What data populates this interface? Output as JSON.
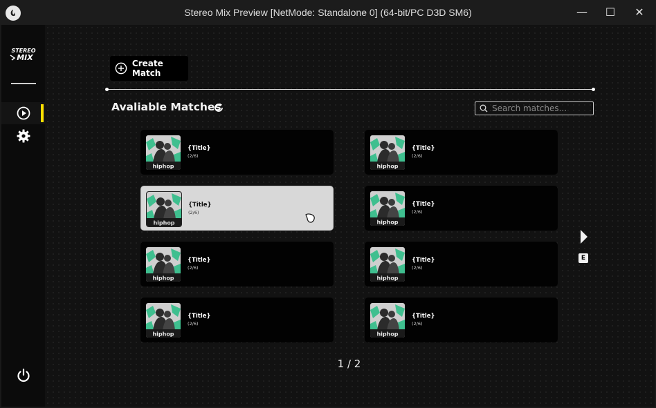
{
  "window": {
    "title": "Stereo Mix Preview [NetMode: Standalone 0]  (64-bit/PC D3D SM6)",
    "minimize_glyph": "—",
    "maximize_glyph": "☐",
    "close_glyph": "✕"
  },
  "brand": {
    "logo_text_line1": "STEREO",
    "logo_text_line2": "MIX"
  },
  "sidebar": {
    "items": [
      {
        "icon": "play-icon",
        "active": true
      },
      {
        "icon": "gear-icon",
        "active": false
      }
    ],
    "bottom_icon": "power-icon",
    "indicator_color": "#ffe000"
  },
  "toolbar": {
    "create_label": "Create Match"
  },
  "section": {
    "title": "Avaliable Matches"
  },
  "search": {
    "placeholder": "Search matches..."
  },
  "matches": [
    {
      "title": "{Title}",
      "players": "(2/6)",
      "thumb_label": "hiphop"
    },
    {
      "title": "{Title}",
      "players": "(2/6)",
      "thumb_label": "hiphop"
    },
    {
      "title": "{Title}",
      "players": "(2/6)",
      "thumb_label": "hiphop",
      "selected": true
    },
    {
      "title": "{Title}",
      "players": "(2/6)",
      "thumb_label": "hiphop"
    },
    {
      "title": "{Title}",
      "players": "(2/6)",
      "thumb_label": "hiphop"
    },
    {
      "title": "{Title}",
      "players": "(2/6)",
      "thumb_label": "hiphop"
    },
    {
      "title": "{Title}",
      "players": "(2/6)",
      "thumb_label": "hiphop"
    },
    {
      "title": "{Title}",
      "players": "(2/6)",
      "thumb_label": "hiphop"
    }
  ],
  "pager": {
    "next_key": "E",
    "page_text": "1 / 2"
  },
  "colors": {
    "accent": "#ffe000",
    "thumb_green": "#3fbf8f"
  }
}
